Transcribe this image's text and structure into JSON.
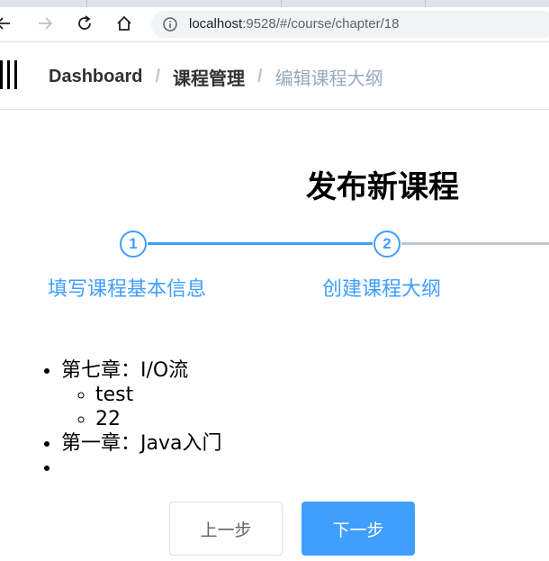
{
  "browser": {
    "url_host": "localhost",
    "url_path": ":9528/#/course/chapter/18"
  },
  "breadcrumb": {
    "home": "Dashboard",
    "section": "课程管理",
    "current": "编辑课程大纲",
    "separator": "/"
  },
  "page": {
    "title": "发布新课程"
  },
  "steps": [
    {
      "number": "1",
      "label": "填写课程基本信息",
      "status": "done"
    },
    {
      "number": "2",
      "label": "创建课程大纲",
      "status": "active"
    }
  ],
  "chapters": [
    {
      "title": "第七章：I/O流",
      "sections": [
        "test",
        "22"
      ]
    },
    {
      "title": "第一章：Java入门",
      "sections": []
    },
    {
      "title": "",
      "sections": []
    }
  ],
  "actions": {
    "prev_label": "上一步",
    "next_label": "下一步"
  },
  "colors": {
    "accent": "#409eff",
    "muted": "#c0c4cc"
  }
}
